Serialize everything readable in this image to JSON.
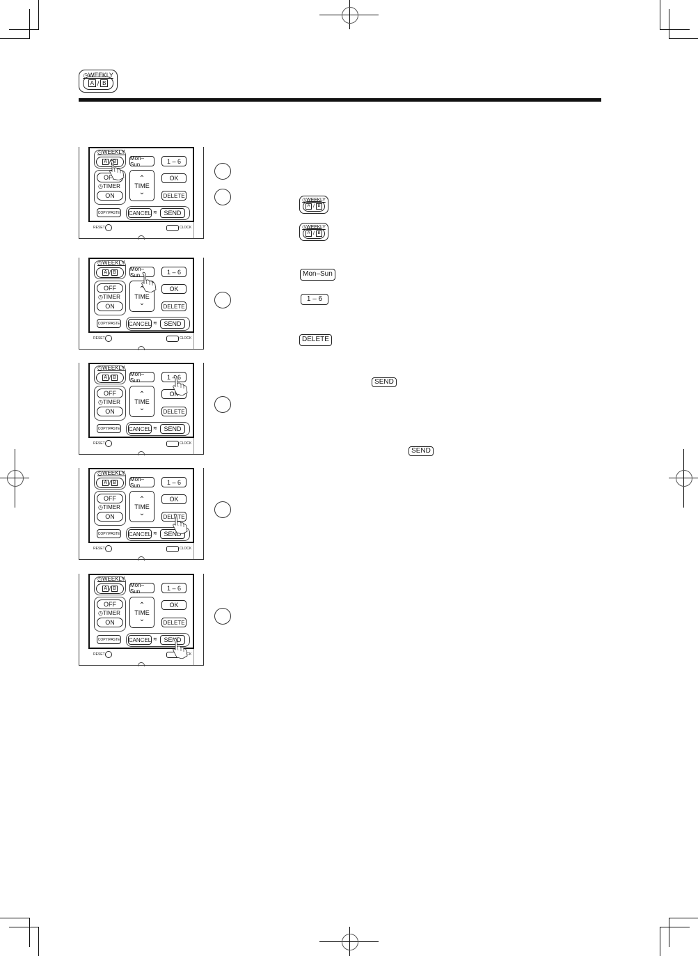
{
  "page": {
    "header_key": {
      "label_top": "WEEKLY",
      "label_a": "A",
      "label_sep": "/",
      "label_b": "B",
      "icon": "clock-icon"
    }
  },
  "remote": {
    "weekly_label": "WEEKLY",
    "ab_a": "A",
    "ab_sep": "/",
    "ab_b": "B",
    "mon_sun": "Mon–Sun",
    "one_six": "1 – 6",
    "off": "OFF",
    "timer": "TIMER",
    "on": "ON",
    "time": "TIME",
    "time_up": "^",
    "time_down": "v",
    "ok": "OK",
    "delete": "DELETE",
    "copy_paste": "COPY/PASTE",
    "cancel": "CANCEL",
    "send": "SEND",
    "reset": "RESET",
    "clock": "CLOCK"
  },
  "panels": [
    {
      "pressed": "weekly-ab"
    },
    {
      "pressed": "mon-sun"
    },
    {
      "pressed": "one-six"
    },
    {
      "pressed": "delete"
    },
    {
      "pressed": "send"
    }
  ],
  "steps": [
    {
      "number": ""
    },
    {
      "number": ""
    },
    {
      "number": ""
    },
    {
      "number": ""
    },
    {
      "number": ""
    },
    {
      "number": ""
    }
  ],
  "inline_keys": {
    "weekly_1": {
      "top": "WEEKLY",
      "a": "A",
      "sep": "/",
      "b": "B"
    },
    "weekly_2": {
      "top": "WEEKLY",
      "a": "A",
      "sep": "/",
      "b": "B"
    },
    "mon_sun": "Mon–Sun",
    "one_six": "1 – 6",
    "delete": "DELETE",
    "send_1": "SEND",
    "send_2": "SEND"
  }
}
